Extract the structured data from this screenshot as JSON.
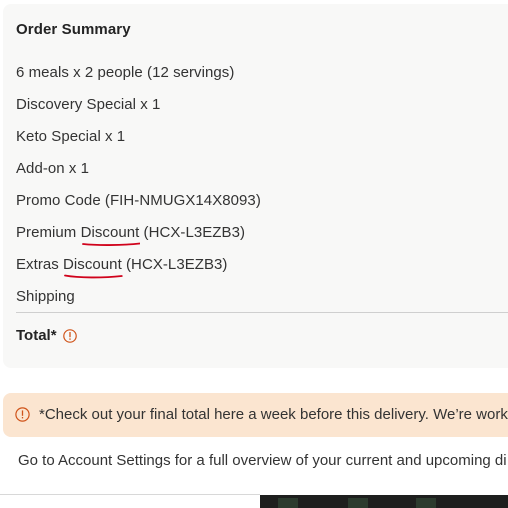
{
  "order_summary": {
    "title": "Order Summary",
    "items": [
      {
        "label": "6 meals x 2 people (12 servings)"
      },
      {
        "label": "Discovery Special x 1"
      },
      {
        "label": "Keto Special x 1"
      },
      {
        "label": "Add-on x 1"
      },
      {
        "label": "Promo Code (FIH-NMUGX14X8093)"
      },
      {
        "prefix": "Premium ",
        "underlined": "Discount",
        "suffix": " (HCX-L3EZB3)"
      },
      {
        "prefix": "Extras ",
        "underlined": "Discount",
        "suffix": " (HCX-L3EZB3)"
      },
      {
        "label": "Shipping"
      }
    ],
    "total_label": "Total*"
  },
  "notice": {
    "text": "*Check out your final total here a week before this delivery. We’re work"
  },
  "account_text": "Go to Account Settings for a full overview of your current and upcoming di",
  "colors": {
    "card_bg": "#f8f8f7",
    "notice_bg": "#fbe5d0",
    "info_icon": "#d0541a",
    "annotation_red": "#d0021b"
  },
  "icons": {
    "total_info": "info-circle-icon",
    "notice_info": "info-circle-icon"
  }
}
